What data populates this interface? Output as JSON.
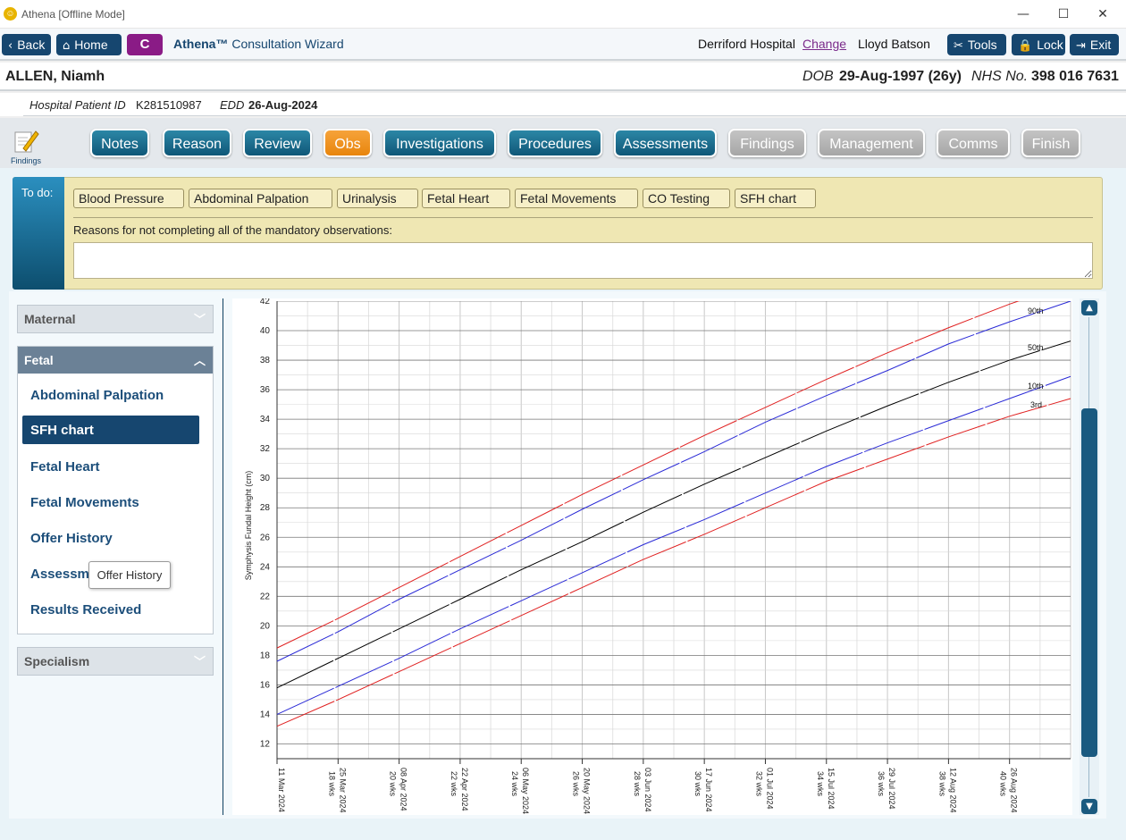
{
  "window": {
    "title": "Athena [Offline Mode]",
    "minimize": "—",
    "maximize": "☐",
    "close": "✕"
  },
  "toolbar": {
    "back": "Back",
    "home": "Home",
    "c": "C",
    "brand": "Athena™",
    "wizard": "Consultation Wizard",
    "hospital": "Derriford Hospital",
    "change": "Change",
    "user": "Lloyd Batson",
    "tools": "Tools",
    "lock": "Lock",
    "exit": "Exit"
  },
  "patient": {
    "name": "ALLEN, Niamh",
    "dob_label": "DOB",
    "dob": "29-Aug-1997 (26y)",
    "nhs_label": "NHS No.",
    "nhs": "398 016 7631",
    "hospital_id_label": "Hospital Patient ID",
    "hospital_id": "K281510987",
    "edd_label": "EDD",
    "edd": "26-Aug-2024"
  },
  "findings_icon_label": "Findings",
  "steps": [
    "Notes",
    "Reason",
    "Review",
    "Obs",
    "Investigations",
    "Procedures",
    "Assessments",
    "Findings",
    "Management",
    "Comms",
    "Finish"
  ],
  "todo": {
    "label": "To do:",
    "items": [
      "Blood Pressure",
      "Abdominal Palpation",
      "Urinalysis",
      "Fetal Heart",
      "Fetal Movements",
      "CO Testing",
      "SFH chart"
    ],
    "reason_label": "Reasons for not completing all of the mandatory observations:",
    "reason_value": ""
  },
  "sidebar": {
    "maternal": "Maternal",
    "fetal": "Fetal",
    "fetal_items": [
      "Abdominal Palpation",
      "SFH chart",
      "Fetal Heart",
      "Fetal Movements",
      "Offer History",
      "Assessme",
      "Results Received"
    ],
    "specialism": "Specialism",
    "tooltip": "Offer History"
  },
  "colors": {
    "primary": "#16466f",
    "accent": "#8a1b86",
    "current_step": "#f39a22"
  },
  "chart_data": {
    "type": "line",
    "ylabel": "Symphysis Fundal Height (cm)",
    "ylim": [
      11,
      42
    ],
    "y_ticks": [
      12,
      14,
      16,
      18,
      20,
      22,
      24,
      26,
      28,
      30,
      32,
      34,
      36,
      38,
      40,
      42
    ],
    "x_ticks": [
      {
        "date": "11 Mar 2024",
        "weeks": ""
      },
      {
        "date": "25 Mar 2024",
        "weeks": "18 wks"
      },
      {
        "date": "08 Apr 2024",
        "weeks": "20 wks"
      },
      {
        "date": "22 Apr 2024",
        "weeks": "22 wks"
      },
      {
        "date": "06 May 2024",
        "weeks": "24 wks"
      },
      {
        "date": "20 May 2024",
        "weeks": "26 wks"
      },
      {
        "date": "03 Jun 2024",
        "weeks": "28 wks"
      },
      {
        "date": "17 Jun 2024",
        "weeks": "30 wks"
      },
      {
        "date": "01 Jul 2024",
        "weeks": "32 wks"
      },
      {
        "date": "15 Jul 2024",
        "weeks": "34 wks"
      },
      {
        "date": "29 Jul 2024",
        "weeks": "36 wks"
      },
      {
        "date": "12 Aug 2024",
        "weeks": "38 wks"
      },
      {
        "date": "26 Aug 2024",
        "weeks": "40 wks"
      }
    ],
    "x_weeks": [
      16,
      18,
      20,
      22,
      24,
      26,
      28,
      30,
      32,
      34,
      36,
      38,
      40,
      42
    ],
    "series": [
      {
        "name": "90th",
        "color": "#2a2ad6",
        "values": [
          17.6,
          19.6,
          21.8,
          23.8,
          25.8,
          27.9,
          29.9,
          31.8,
          33.8,
          35.6,
          37.3,
          39.1,
          40.6,
          42.0
        ]
      },
      {
        "name": "50th",
        "color": "#000000",
        "values": [
          15.8,
          17.8,
          19.8,
          21.8,
          23.8,
          25.7,
          27.7,
          29.6,
          31.4,
          33.2,
          34.9,
          36.5,
          38.0,
          39.3
        ]
      },
      {
        "name": "10th",
        "color": "#2a2ad6",
        "values": [
          14.0,
          15.9,
          17.8,
          19.8,
          21.7,
          23.6,
          25.5,
          27.2,
          29.0,
          30.8,
          32.4,
          33.9,
          35.4,
          36.9
        ]
      }
    ],
    "outer_series": [
      {
        "color": "#e02020",
        "values": [
          18.5,
          20.5,
          22.6,
          24.7,
          26.8,
          28.9,
          30.9,
          32.9,
          34.8,
          36.7,
          38.5,
          40.2,
          41.8,
          43.2
        ]
      },
      {
        "color": "#e02020",
        "values": [
          13.2,
          15.0,
          16.9,
          18.8,
          20.7,
          22.6,
          24.5,
          26.2,
          28.0,
          29.8,
          31.3,
          32.8,
          34.2,
          35.4
        ]
      }
    ],
    "lower_red_label": "3rd"
  }
}
